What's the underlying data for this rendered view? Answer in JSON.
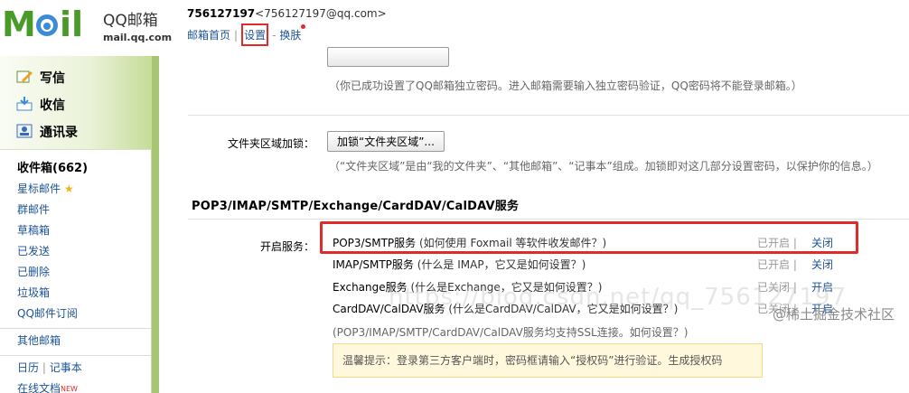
{
  "header": {
    "logo_text": "MOil",
    "product": "QQ邮箱",
    "domain": "mail.qq.com",
    "account_id": "756127197",
    "account_email": "<756127197@qq.com>",
    "links": {
      "home": "邮箱首页",
      "settings": "设置",
      "skin": "换肤"
    }
  },
  "sidebar": {
    "actions": [
      {
        "label": "写信",
        "icon": "compose-icon"
      },
      {
        "label": "收信",
        "icon": "receive-icon"
      },
      {
        "label": "通讯录",
        "icon": "contacts-icon"
      }
    ],
    "inbox": "收件箱(662)",
    "folders": [
      "星标邮件",
      "群邮件",
      "草稿箱",
      "已发送",
      "已删除",
      "垃圾箱",
      "QQ邮件订阅"
    ],
    "other": "其他邮箱",
    "calendar": "日历",
    "notes": "记事本",
    "online_docs": "在线文档",
    "new_badge": "NEW"
  },
  "main": {
    "password_hint": "（你已成功设置了QQ邮箱独立密码。进入邮箱需要输入独立密码验证，QQ密码将不能登录邮箱。）",
    "folder_lock_label": "文件夹区域加锁：",
    "folder_lock_button": "加锁“文件夹区域”...",
    "folder_lock_hint": "（“文件夹区域”是由“我的文件夹”、“其他邮箱”、“记事本”组成。加锁即对这几部分设置密码，以保护你的信息。）",
    "section_title": "POP3/IMAP/SMTP/Exchange/CardDAV/CalDAV服务",
    "services_label": "开启服务：",
    "services": [
      {
        "name": "POP3/SMTP服务",
        "help": "(如何使用 Foxmail 等软件收发邮件？)",
        "status": "已开启",
        "action": "关闭"
      },
      {
        "name": "IMAP/SMTP服务",
        "help": "(什么是 IMAP，它又是如何设置？)",
        "status": "已开启",
        "action": "关闭"
      },
      {
        "name": "Exchange服务",
        "help": "(什么是Exchange，它又是如何设置？)",
        "status": "已关闭",
        "action": "开启"
      },
      {
        "name": "CardDAV/CalDAV服务",
        "help": "(什么是CardDAV/CalDAV，它又是如何设置？)",
        "status": "已关闭",
        "action": "开启"
      }
    ],
    "ssl_note": "(POP3/IMAP/SMTP/CardDAV/CalDAV服务均支持SSL连接。如何设置？)",
    "notice": "温馨提示：登录第三方客户端时，密码框请输入“授权码”进行验证。生成授权码",
    "watermark": "@稀土掘金技术社区",
    "ghost_watermark": "https://blog.csdn.net/qq_756127197"
  },
  "colors": {
    "accent_red": "#e12a2a",
    "link_blue": "#1e5494",
    "sidebar_green": "#a6c674"
  }
}
